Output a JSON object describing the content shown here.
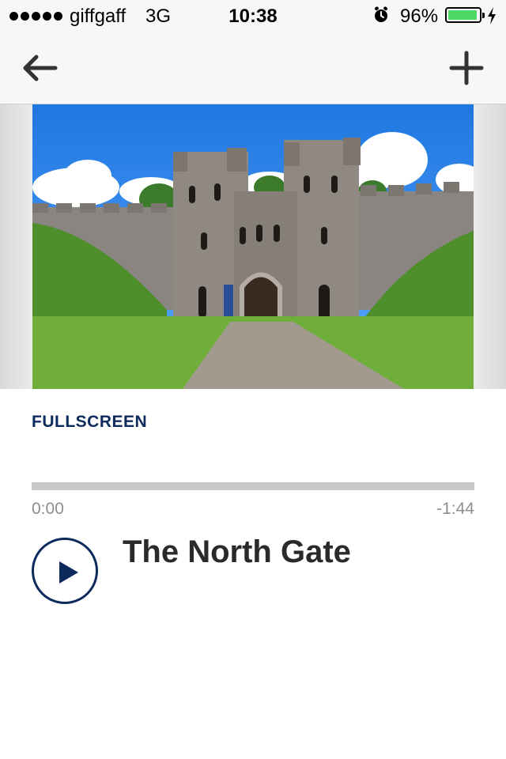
{
  "status_bar": {
    "carrier": "giffgaff",
    "network": "3G",
    "time": "10:38",
    "battery_percent": "96%",
    "battery_level": 0.96,
    "battery_color": "#4cd964",
    "icons": [
      "signal-dots-icon",
      "alarm-icon",
      "battery-icon",
      "charging-bolt-icon"
    ]
  },
  "nav": {
    "back_icon": "arrow-left-icon",
    "add_icon": "plus-icon"
  },
  "media": {
    "image_subject": "castle-north-gate-photo"
  },
  "player": {
    "fullscreen_label": "FULLSCREEN",
    "elapsed": "0:00",
    "remaining": "-1:44",
    "progress": 0.0,
    "play_icon": "play-icon",
    "title": "The North Gate",
    "accent_color": "#0d2a5c",
    "track_color": "#c9c9c9"
  }
}
